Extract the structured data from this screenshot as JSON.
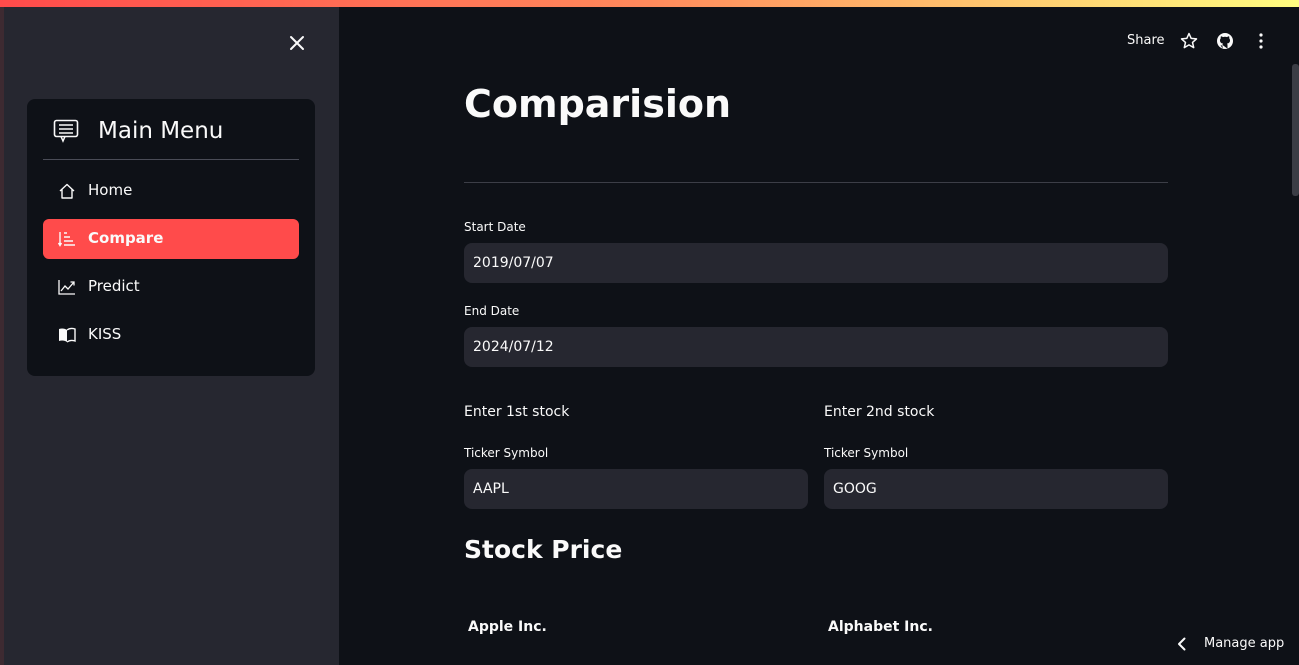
{
  "sidebar": {
    "menu_title": "Main Menu",
    "menu_icon": "menu-card-icon",
    "items": [
      {
        "label": "Home",
        "icon": "house-icon",
        "active": false
      },
      {
        "label": "Compare",
        "icon": "sort-list-icon",
        "active": true
      },
      {
        "label": "Predict",
        "icon": "graph-up-icon",
        "active": false
      },
      {
        "label": "KISS",
        "icon": "book-icon",
        "active": false
      }
    ],
    "accent_color": "#ff4b4b"
  },
  "toolbar": {
    "share_label": "Share",
    "icons": [
      "star-icon",
      "github-icon",
      "more-vertical-icon"
    ]
  },
  "main": {
    "title": "Comparision",
    "start_date": {
      "label": "Start Date",
      "value": "2019/07/07"
    },
    "end_date": {
      "label": "End Date",
      "value": "2024/07/12"
    },
    "stock1": {
      "heading": "Enter 1st stock",
      "label": "Ticker Symbol",
      "value": "AAPL"
    },
    "stock2": {
      "heading": "Enter 2nd stock",
      "label": "Ticker Symbol",
      "value": "GOOG"
    },
    "section_title": "Stock Price",
    "company1": "Apple Inc.",
    "company2": "Alphabet Inc."
  },
  "footer": {
    "manage_app_label": "Manage app"
  }
}
